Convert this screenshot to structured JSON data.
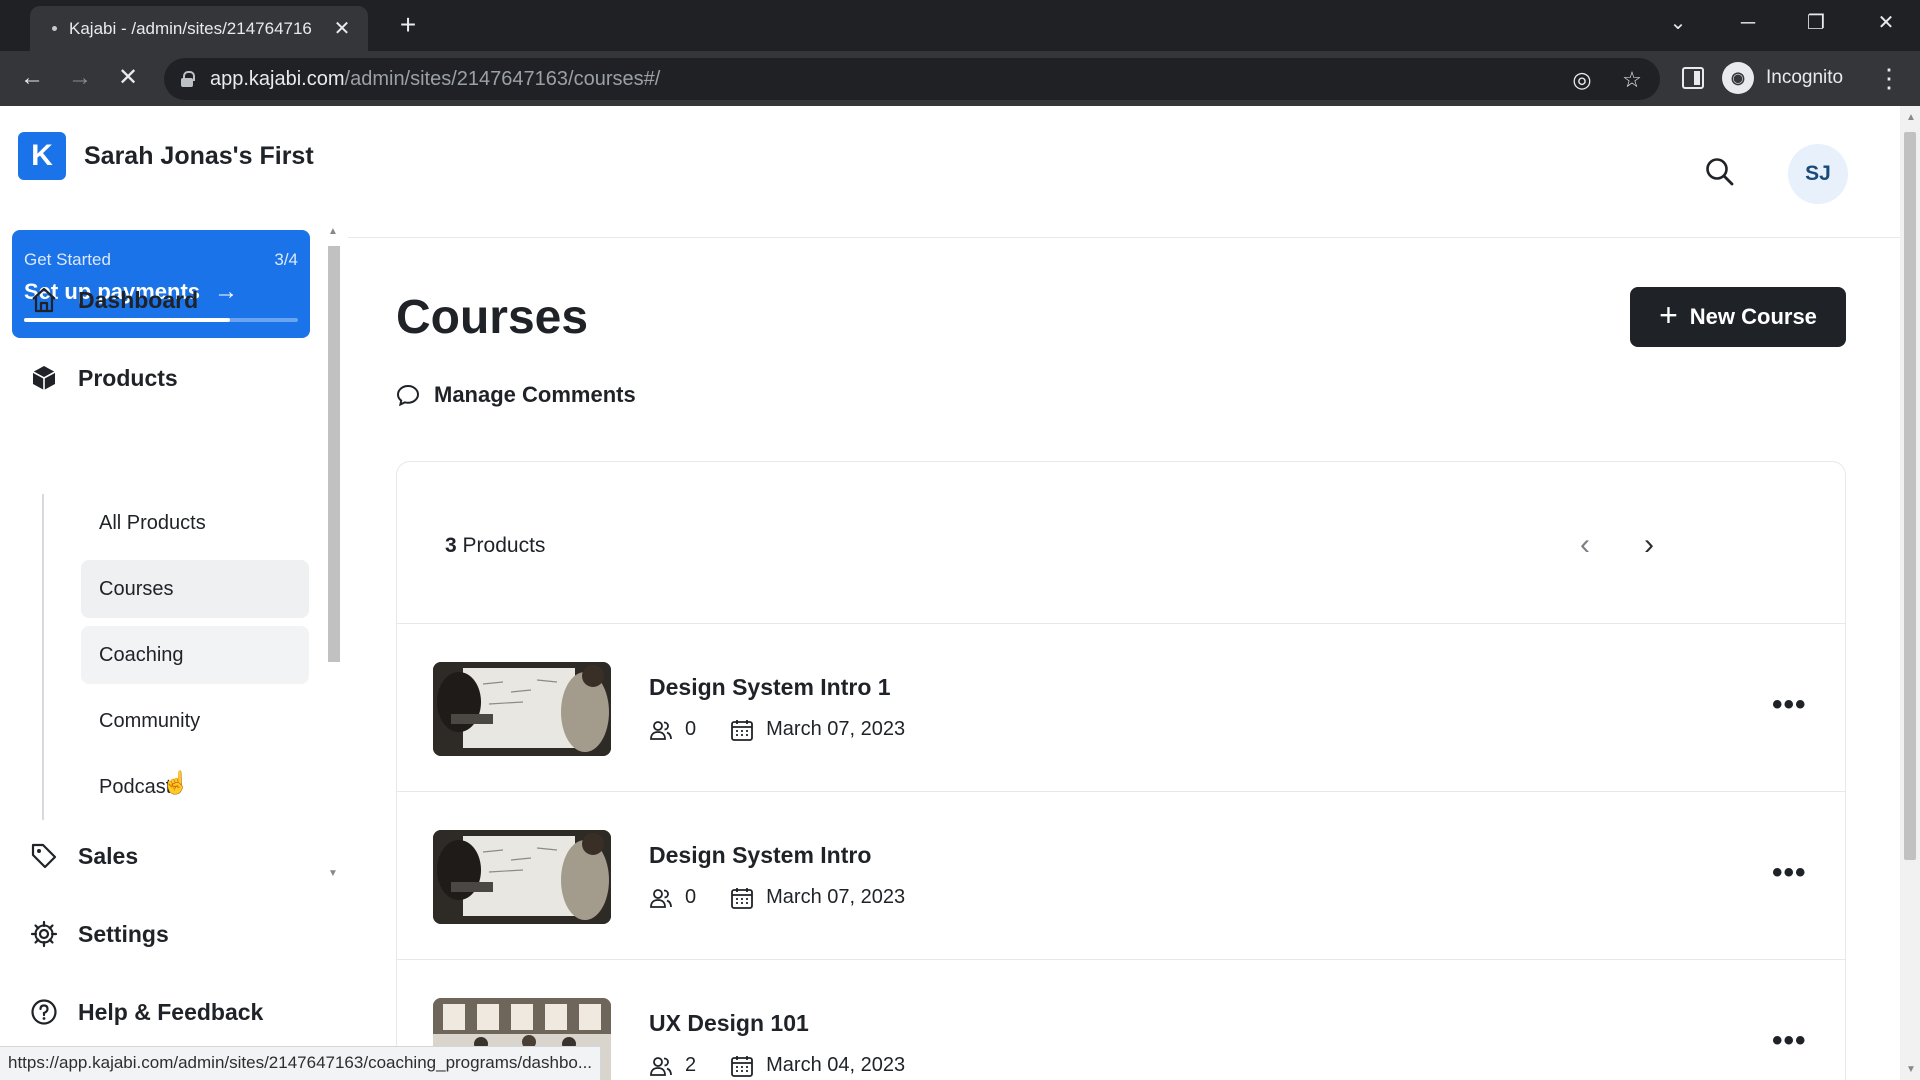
{
  "browser": {
    "tab_title": "Kajabi - /admin/sites/214764716",
    "url_host": "app.kajabi.com",
    "url_path": "/admin/sites/2147647163/courses#/",
    "profile_label": "Incognito"
  },
  "brand": {
    "logo_letter": "K",
    "site_name": "Sarah Jonas's First"
  },
  "get_started": {
    "label": "Get Started",
    "progress_text": "3/4",
    "title": "Set up payments",
    "progress_fraction": 0.75
  },
  "nav": {
    "dashboard": "Dashboard",
    "products": "Products",
    "sales": "Sales",
    "settings": "Settings",
    "help": "Help & Feedback"
  },
  "products_submenu": [
    "All Products",
    "Courses",
    "Coaching",
    "Community",
    "Podcasts"
  ],
  "header": {
    "avatar_initials": "SJ"
  },
  "page": {
    "title": "Courses",
    "new_course_label": "New Course",
    "manage_comments_label": "Manage Comments"
  },
  "list": {
    "count": "3",
    "count_label": "Products",
    "items": [
      {
        "title": "Design System Intro 1",
        "members": "0",
        "date": "March 07, 2023"
      },
      {
        "title": "Design System Intro",
        "members": "0",
        "date": "March 07, 2023"
      },
      {
        "title": "UX Design 101",
        "members": "2",
        "date": "March 04, 2023"
      }
    ]
  },
  "status_bar_url": "https://app.kajabi.com/admin/sites/2147647163/coaching_programs/dashbo...",
  "colors": {
    "brand_blue": "#1a73e8",
    "primary_button": "#1f2328",
    "active_nav_bg": "#eef0f2"
  }
}
